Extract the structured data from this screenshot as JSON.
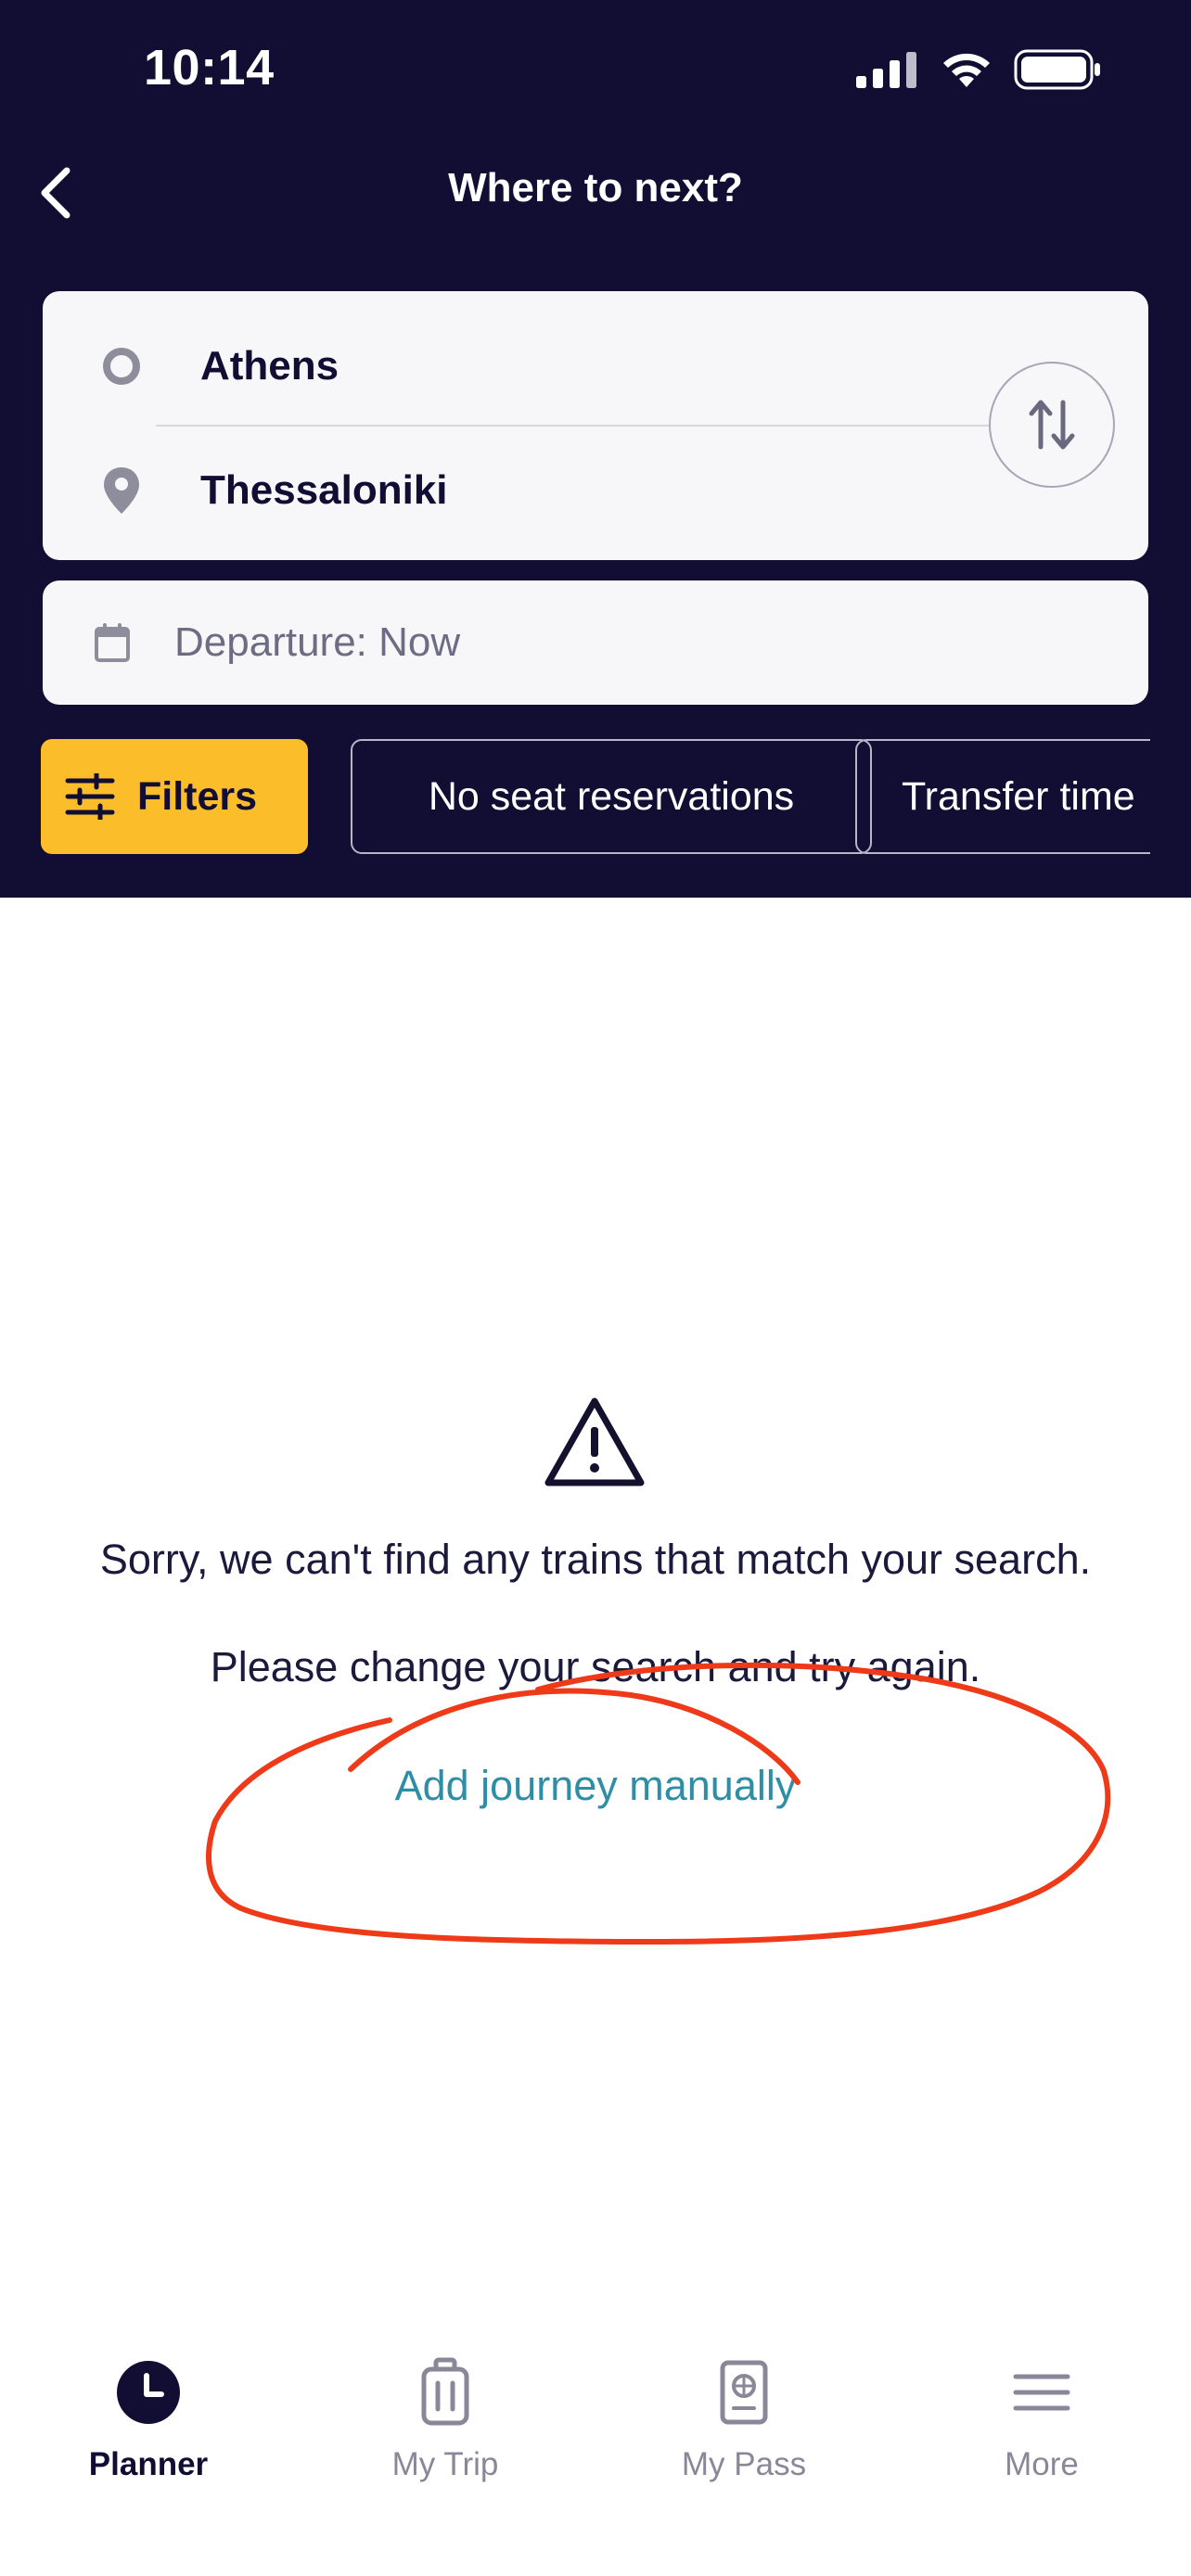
{
  "status_bar": {
    "time": "10:14"
  },
  "header": {
    "title": "Where to next?"
  },
  "route": {
    "from": "Athens",
    "to": "Thessaloniki"
  },
  "date": {
    "label": "Departure: Now"
  },
  "chips": {
    "filters": "Filters",
    "seat": "No seat reservations",
    "transfer": "Transfer time"
  },
  "empty_state": {
    "message1": "Sorry, we can't find any trains that match your search.",
    "message2": "Please change your search and try again.",
    "link": "Add journey manually"
  },
  "tabs": [
    {
      "label": "Planner",
      "icon": "clock-icon",
      "active": true
    },
    {
      "label": "My Trip",
      "icon": "luggage-icon",
      "active": false
    },
    {
      "label": "My Pass",
      "icon": "passport-icon",
      "active": false
    },
    {
      "label": "More",
      "icon": "menu-icon",
      "active": false
    }
  ],
  "colors": {
    "header_bg": "#110d33",
    "filters_chip": "#fbbd2a",
    "link": "#2d8ea6",
    "annotation": "#ee3a18"
  }
}
